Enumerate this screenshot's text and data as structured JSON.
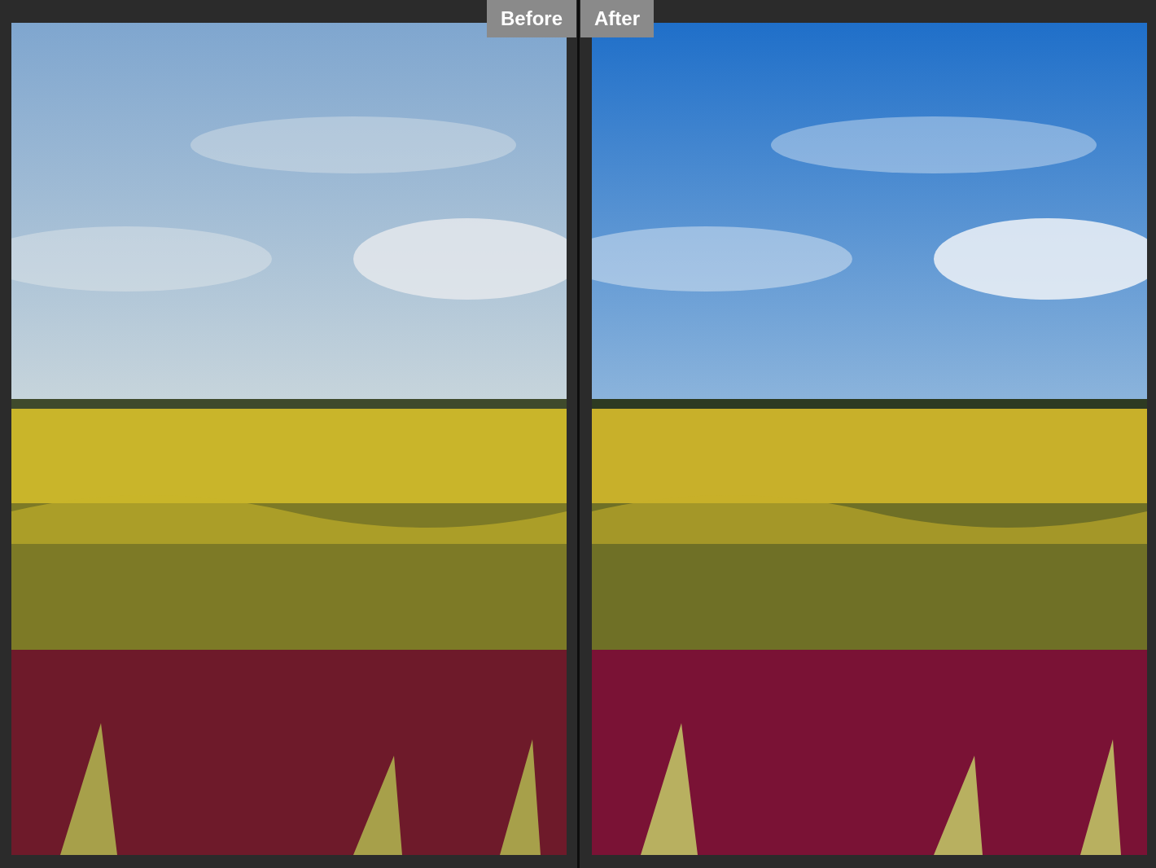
{
  "panels": [
    {
      "label": "Before"
    },
    {
      "label": "After"
    }
  ]
}
